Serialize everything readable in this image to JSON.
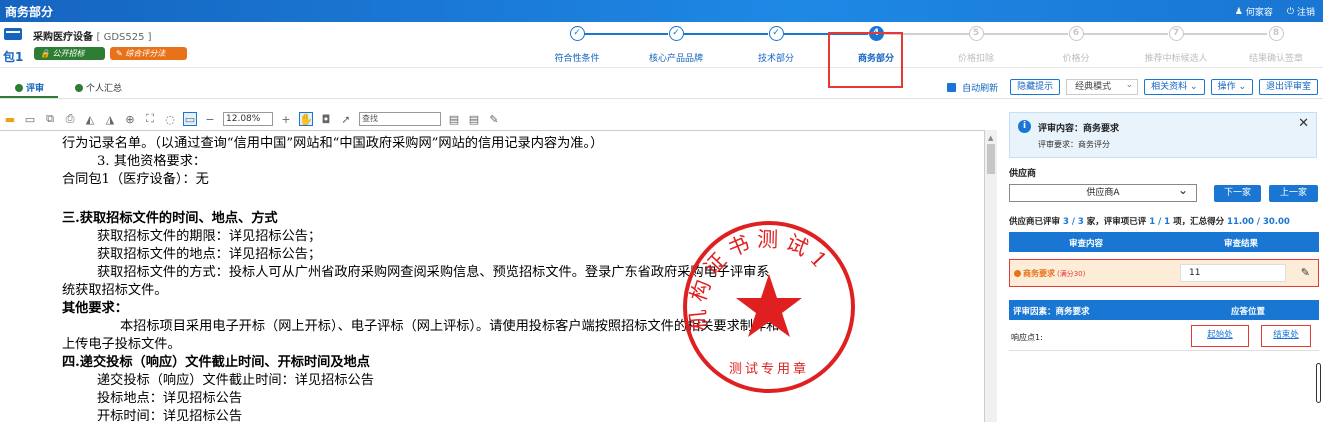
{
  "header": {
    "title": "商务部分",
    "user": "何家容",
    "logout": "注销"
  },
  "project": {
    "name": "采购医疗设备",
    "code": "[ GDS525 ]",
    "package": "包1",
    "tags": [
      "公开招标",
      "综合评分法"
    ]
  },
  "steps": [
    {
      "num": "1",
      "label": "符合性条件",
      "state": "done"
    },
    {
      "num": "2",
      "label": "核心产品品牌",
      "state": "done"
    },
    {
      "num": "3",
      "label": "技术部分",
      "state": "done"
    },
    {
      "num": "4",
      "label": "商务部分",
      "state": "active"
    },
    {
      "num": "5",
      "label": "价格扣除",
      "state": "todo"
    },
    {
      "num": "6",
      "label": "价格分",
      "state": "todo"
    },
    {
      "num": "7",
      "label": "推荐中标候选人",
      "state": "todo"
    },
    {
      "num": "8",
      "label": "结果确认签章",
      "state": "todo"
    }
  ],
  "tabs": [
    "评审",
    "个人汇总"
  ],
  "controls": {
    "auto_refresh": "自动刷新",
    "hide_tips": "隐藏提示",
    "mode": "经典模式",
    "related": "相关资料",
    "operate": "操作",
    "exit": "退出评审室"
  },
  "toolbar": {
    "zoom": "12.08%",
    "find_placeholder": "查找"
  },
  "document": {
    "lines": [
      "行为记录名单。（以通过查询“信用中国”网站和“中国政府采购网”网站的信用记录内容为准。）",
      "3. 其他资格要求：",
      "合同包1（医疗设备）：无",
      "三.获取招标文件的时间、地点、方式",
      "获取招标文件的期限：详见招标公告；",
      "获取招标文件的地点：详见招标公告；",
      "获取招标文件的方式：投标人可从广州省政府采购网查阅采购信息、预览招标文件。登录广东省政府采购电子评审系",
      "统获取招标文件。",
      "其他要求：",
      "本招标项目采用电子开标（网上开标）、电子评标（网上评标）。请使用投标客户端按照招标文件的相关要求制作和",
      "上传电子投标文件。",
      "四.递交投标（响应）文件截止时间、开标时间及地点",
      "递交投标（响应）文件截止时间：详见招标公告",
      "投标地点：详见招标公告",
      "开标时间：详见招标公告"
    ],
    "stamp_text": "测试专用章",
    "stamp_ring": "机构证书测试1"
  },
  "side": {
    "info_title": "评审内容：商务要求",
    "info_sub": "评审要求：商务评分",
    "supplier_label": "供应商",
    "supplier": "供应商A",
    "next": "下一家",
    "prev": "上一家",
    "summary_a": "供应商已评审 ",
    "summary_b": "3 / 3",
    "summary_c": " 家，评审项已评 ",
    "summary_d": "1 / 1",
    "summary_e": " 项，汇总得分 ",
    "summary_f": "11.00 / 30.00",
    "col_content": "审查内容",
    "col_result": "审查结果",
    "item_name": "商务要求",
    "item_full": "(满分30)",
    "item_score": "11",
    "factor_label": "评审因素：商务要求",
    "position_label": "应答位置",
    "resp_point": "响应点1:",
    "start": "起始处",
    "end": "结束处"
  }
}
